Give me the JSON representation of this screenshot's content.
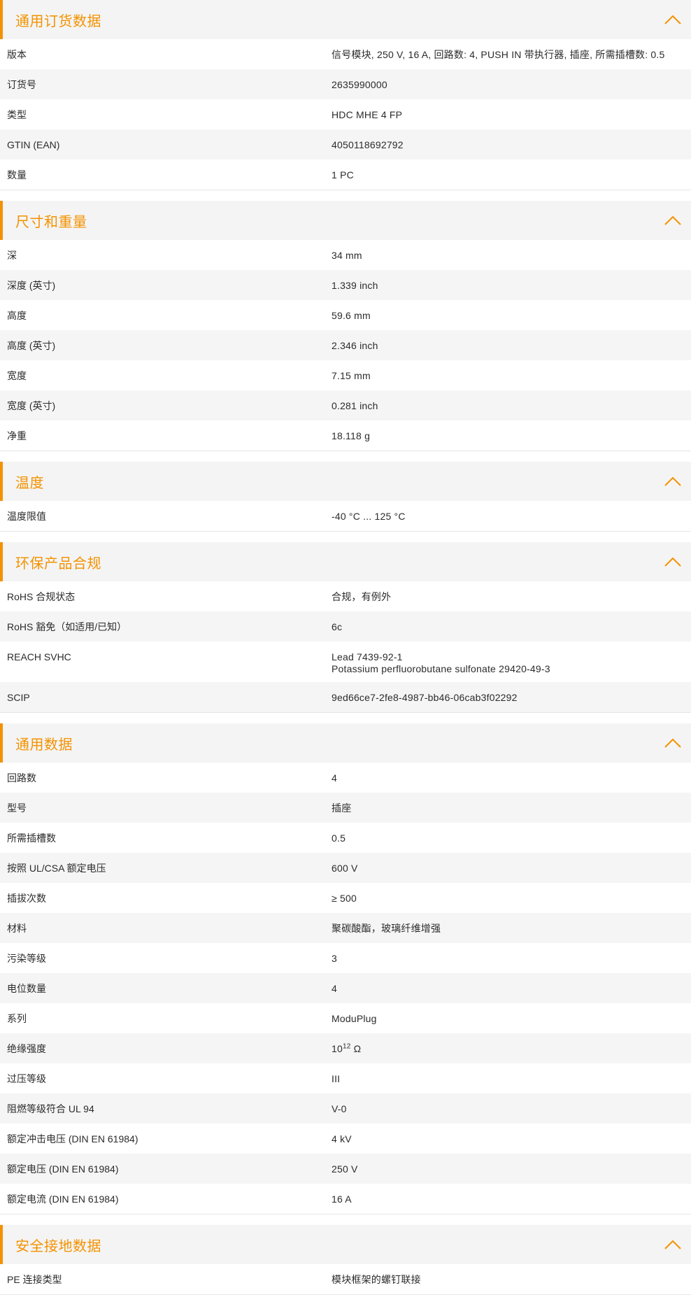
{
  "accent_color": "#f39200",
  "sections": [
    {
      "title": "通用订货数据",
      "icon": "chevron-up-icon",
      "rows": [
        {
          "label": "版本",
          "value": "信号模块, 250 V, 16 A, 回路数: 4, PUSH IN 带执行器, 插座, 所需插槽数: 0.5"
        },
        {
          "label": "订货号",
          "value": "2635990000"
        },
        {
          "label": "类型",
          "value": "HDC MHE 4 FP"
        },
        {
          "label": "GTIN (EAN)",
          "value": "4050118692792"
        },
        {
          "label": "数量",
          "value": "1  PC"
        }
      ]
    },
    {
      "title": "尺寸和重量",
      "icon": "chevron-up-icon",
      "rows": [
        {
          "label": "深",
          "value": "34  mm"
        },
        {
          "label": "深度 (英寸)",
          "value": "1.339  inch"
        },
        {
          "label": "高度",
          "value": "59.6  mm"
        },
        {
          "label": "高度 (英寸)",
          "value": "2.346  inch"
        },
        {
          "label": "宽度",
          "value": "7.15  mm"
        },
        {
          "label": "宽度 (英寸)",
          "value": "0.281  inch"
        },
        {
          "label": "净重",
          "value": "18.118  g"
        }
      ]
    },
    {
      "title": "温度",
      "icon": "chevron-up-icon",
      "rows": [
        {
          "label": "温度限值",
          "value": "-40 °C ... 125 °C"
        }
      ]
    },
    {
      "title": "环保产品合规",
      "icon": "chevron-up-icon",
      "rows": [
        {
          "label": "RoHS 合规状态",
          "value": "合规，有例外"
        },
        {
          "label": "RoHS 豁免（如适用/已知）",
          "value": "6c"
        },
        {
          "label": "REACH SVHC",
          "value": "Lead 7439-92-1\nPotassium perfluorobutane sulfonate 29420-49-3"
        },
        {
          "label": "SCIP",
          "value": "9ed66ce7-2fe8-4987-bb46-06cab3f02292"
        }
      ]
    },
    {
      "title": "通用数据",
      "icon": "chevron-up-icon",
      "rows": [
        {
          "label": "回路数",
          "value": "4"
        },
        {
          "label": "型号",
          "value": "插座"
        },
        {
          "label": "所需插槽数",
          "value": "0.5"
        },
        {
          "label": "按照 UL/CSA 额定电压",
          "value": "600 V"
        },
        {
          "label": "插拔次数",
          "value": "≥ 500"
        },
        {
          "label": "材料",
          "value": "聚碳酸酯，玻璃纤维增强"
        },
        {
          "label": "污染等级",
          "value": "3"
        },
        {
          "label": "电位数量",
          "value": "4"
        },
        {
          "label": "系列",
          "value": "ModuPlug"
        },
        {
          "label": "绝缘强度",
          "value": "10",
          "sup": "12",
          "suffix": " Ω"
        },
        {
          "label": "过压等级",
          "value": "III"
        },
        {
          "label": "阻燃等级符合 UL 94",
          "value": "V-0"
        },
        {
          "label": "额定冲击电压 (DIN EN 61984)",
          "value": "4  kV"
        },
        {
          "label": "额定电压 (DIN EN 61984)",
          "value": "250  V"
        },
        {
          "label": "额定电流 (DIN EN 61984)",
          "value": "16  A"
        }
      ]
    },
    {
      "title": "安全接地数据",
      "icon": "chevron-up-icon",
      "rows": [
        {
          "label": "PE 连接类型",
          "value": "模块框架的螺钉联接"
        }
      ]
    }
  ]
}
